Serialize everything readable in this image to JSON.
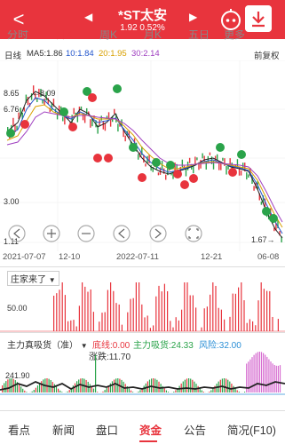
{
  "header": {
    "back": "<",
    "title": "*ST太安",
    "price_change": "1.92  0.52%",
    "prev": "◀",
    "next": "▶"
  },
  "tabs": [
    "分时",
    "日K",
    "周K",
    "月K",
    "五日",
    "更多"
  ],
  "legend": {
    "period": "日线",
    "ma5": "MA5:1.86",
    "ma10": "10:1.84",
    "ma20": "20:1.95",
    "ma30": "30:2.14",
    "adjust": "前复权"
  },
  "price_axis": [
    "8.65",
    "6.76",
    "3.00",
    "1.11"
  ],
  "annotations": {
    "high": "←8.09",
    "low": "1.67→"
  },
  "dates": [
    "2021-07-07",
    "12-10",
    "2022-07-11",
    "12-21",
    "06-08"
  ],
  "panel2": {
    "title": "庄家来了",
    "level": "50.00"
  },
  "panel3": {
    "title": "主力真吸货（准）",
    "bottom_line": "底线:0.00",
    "main_absorb": "主力吸货:24.33",
    "risk": "风险:32.00",
    "rise_fall": "涨跌:11.70",
    "level": "241.90"
  },
  "bottom_nav": [
    "看点",
    "新闻",
    "盘口",
    "资金",
    "公告",
    "简况(F10)"
  ],
  "colors": {
    "up": "#e8343d",
    "down": "#2aa34a",
    "accent": "#e8343d"
  }
}
